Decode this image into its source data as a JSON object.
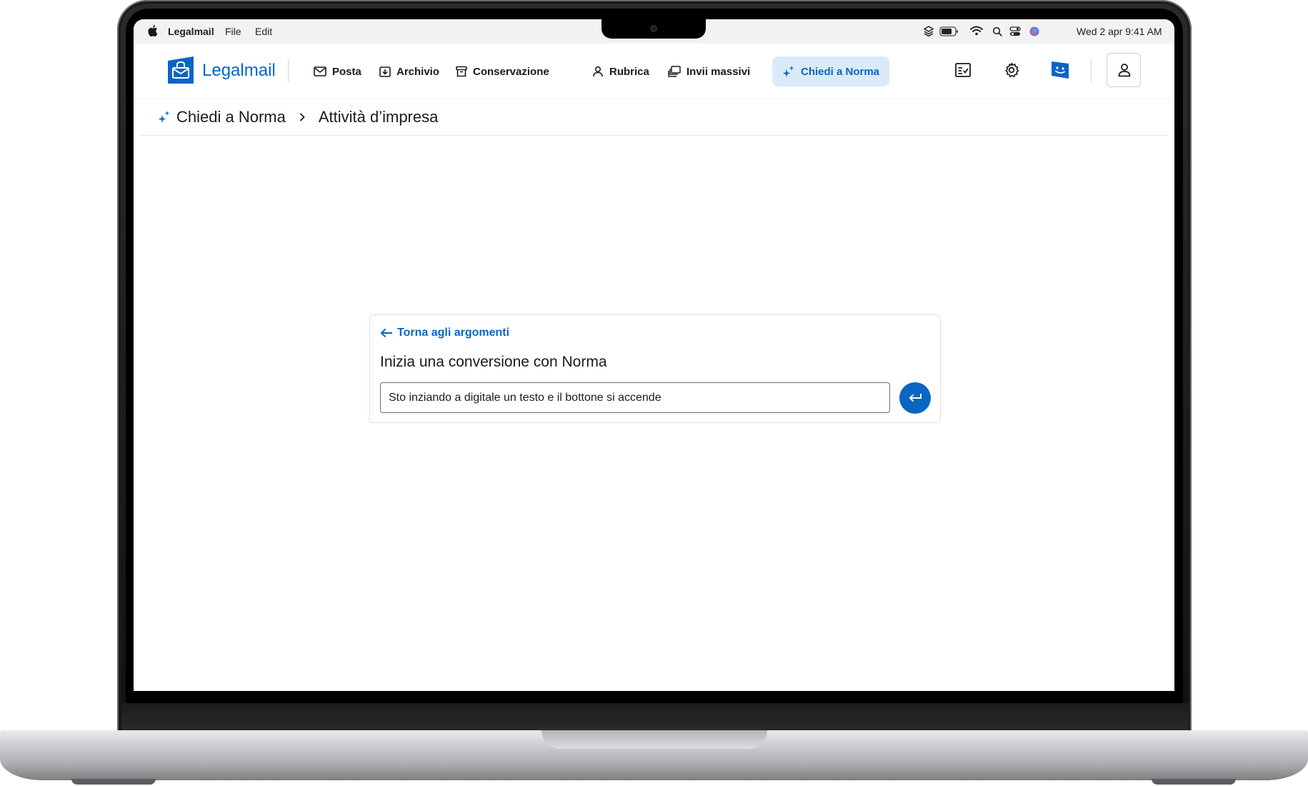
{
  "menubar": {
    "app_name": "Legalmail",
    "menus": [
      "File",
      "Edit"
    ],
    "clock": "Wed 2 apr  9:41 AM",
    "status_icons": [
      "layers-icon",
      "battery-icon",
      "wifi-icon",
      "search-icon",
      "control-center-icon",
      "siri-icon"
    ]
  },
  "header": {
    "brand": "Legalmail",
    "nav": [
      {
        "label": "Posta",
        "icon": "mail-icon"
      },
      {
        "label": "Archivio",
        "icon": "archive-download-icon"
      },
      {
        "label": "Conservazione",
        "icon": "archive-box-icon"
      },
      {
        "label": "Rubrica",
        "icon": "person-icon"
      },
      {
        "label": "Invii massivi",
        "icon": "stack-mail-icon"
      },
      {
        "label": "Chiedi a Norma",
        "icon": "sparkle-icon",
        "active": true
      }
    ],
    "right_icons": [
      "checklist-icon",
      "gear-icon",
      "norma-chat-icon",
      "user-icon"
    ]
  },
  "breadcrumb": {
    "items": [
      "Chiedi a Norma",
      "Attività d’impresa"
    ]
  },
  "card": {
    "back_link": "Torna agli argomenti",
    "title": "Inizia una conversione con Norma",
    "input_value": "Sto inziando a digitale un testo e il bottone si accende"
  },
  "colors": {
    "accent": "#0a66c2",
    "active_nav_bg": "#dbeaf8"
  }
}
